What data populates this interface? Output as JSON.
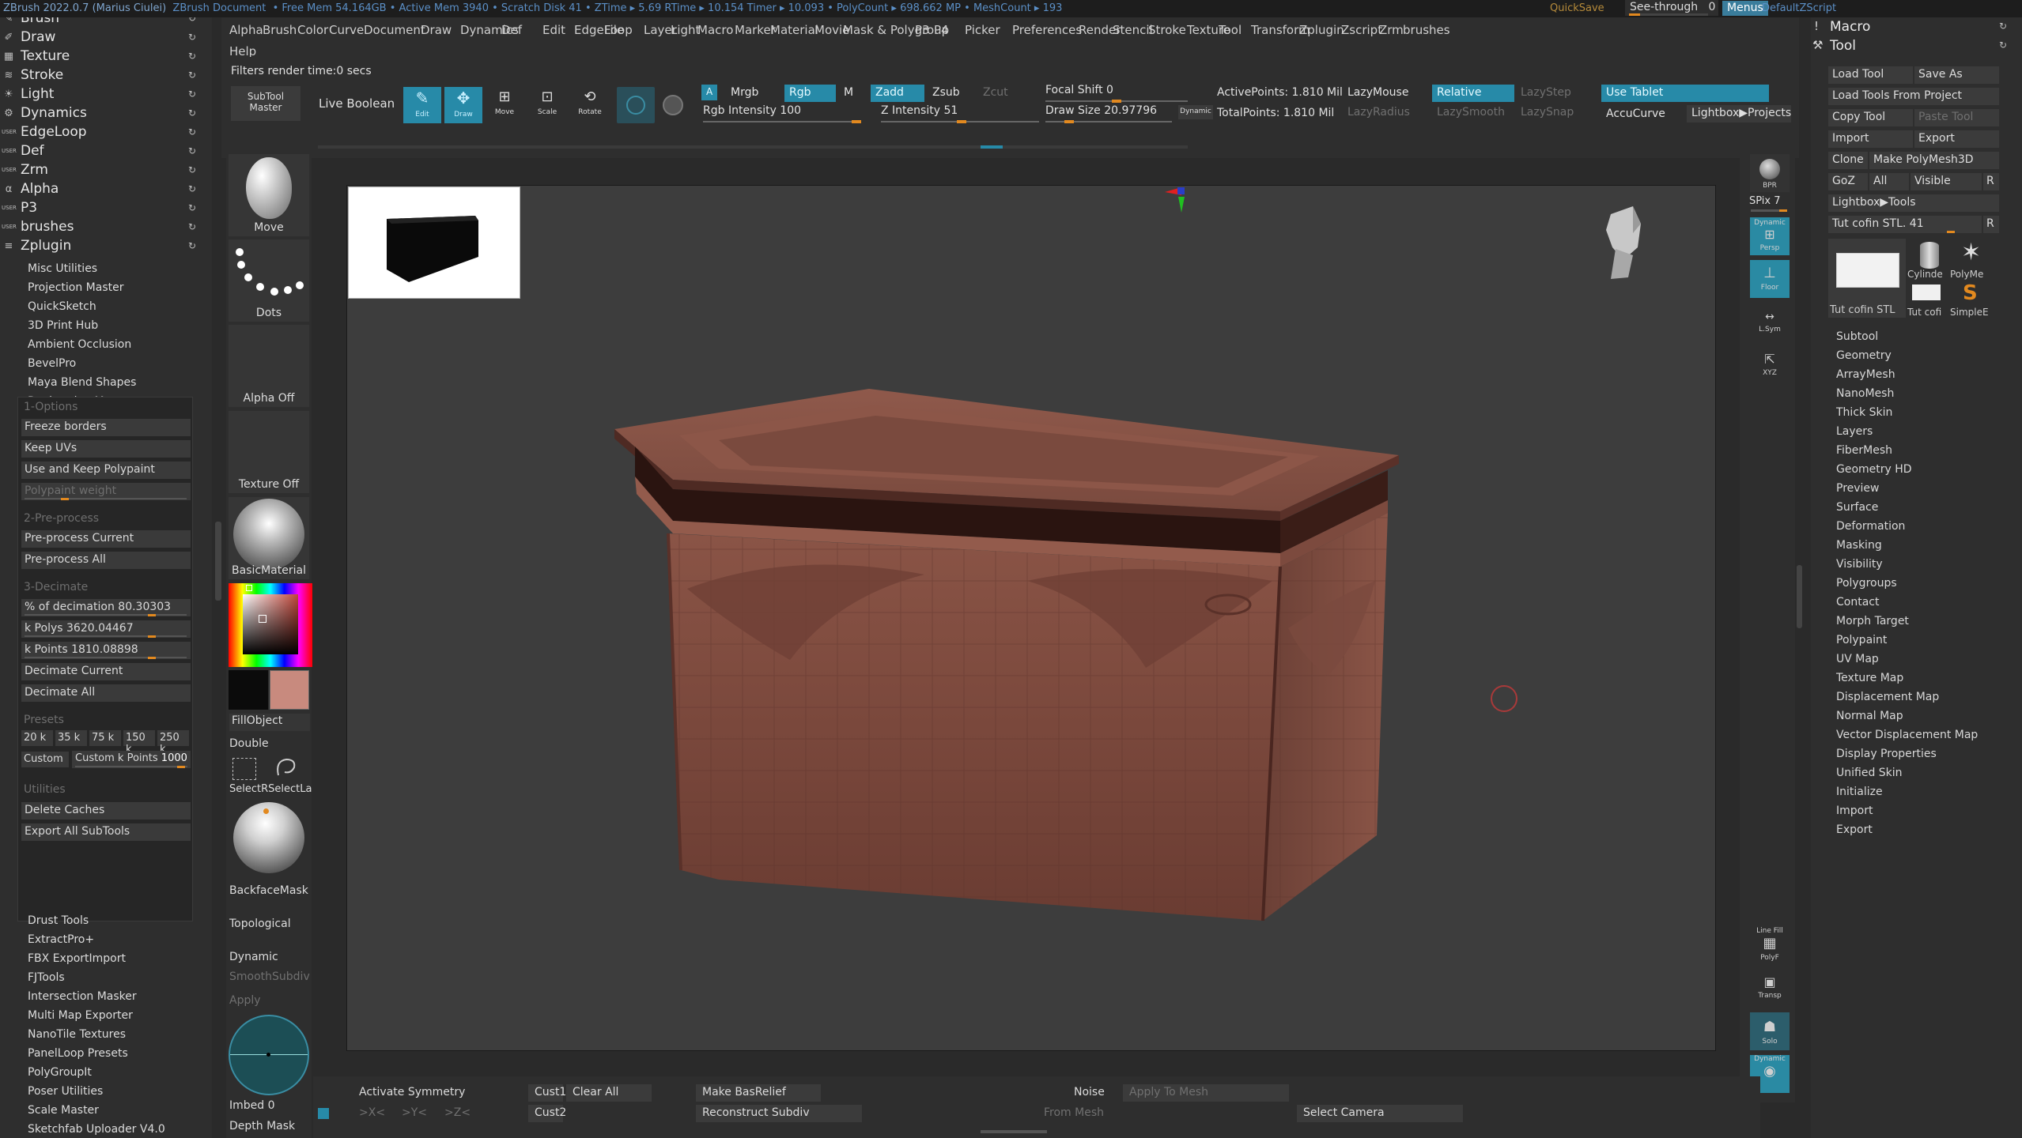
{
  "titlebar": {
    "app": "ZBrush 2022.0.7 (Marius Ciulei)",
    "doc": "ZBrush Document",
    "stats": "• Free Mem 54.164GB • Active Mem 3940 • Scratch Disk 41 • ZTime ▸ 5.69 RTime ▸ 10.154 Timer ▸ 10.093 • PolyCount ▸ 698.662 MP • MeshCount ▸ 193",
    "quicksave": "QuickSave",
    "seethrough": "See-through",
    "seethrough_value": "0",
    "seethrough_level": 0.0,
    "menus": "Menus",
    "default_zscript": "DefaultZScript"
  },
  "menubar": {
    "items": [
      "Alpha",
      "Brush",
      "Color",
      "Curve",
      "Document",
      "Draw",
      "Dynamics",
      "Def",
      "Edit",
      "EdgeLoop",
      "File",
      "Layer",
      "Light",
      "Macro",
      "Marker",
      "Material",
      "Movie",
      "Mask & Polygroup",
      "P3",
      "P4",
      "Picker",
      "Preferences",
      "Render",
      "Stencil",
      "Stroke",
      "Texture",
      "Tool",
      "Transform",
      "Zplugin",
      "Zscript",
      "Zrm",
      "brushes"
    ],
    "help": "Help"
  },
  "left_panel": {
    "menus": [
      {
        "label": "Brush",
        "icon": "brush-icon"
      },
      {
        "label": "Draw",
        "icon": "draw-icon"
      },
      {
        "label": "Texture",
        "icon": "texture-icon"
      },
      {
        "label": "Stroke",
        "icon": "stroke-icon"
      },
      {
        "label": "Light",
        "icon": "light-icon"
      },
      {
        "label": "Dynamics",
        "icon": "dynamics-icon"
      },
      {
        "label": "EdgeLoop",
        "icon": "user-icon"
      },
      {
        "label": "Def",
        "icon": "user-icon"
      },
      {
        "label": "Zrm",
        "icon": "user-icon"
      },
      {
        "label": "Alpha",
        "icon": "alpha-icon"
      },
      {
        "label": "P3",
        "icon": "user-icon"
      },
      {
        "label": "brushes",
        "icon": "user-icon"
      },
      {
        "label": "Zplugin",
        "icon": "plugin-icon"
      }
    ],
    "user_tag": "USER",
    "plugins_top": [
      "Misc Utilities",
      "Projection Master",
      "QuickSketch",
      "3D Print Hub",
      "Ambient Occlusion",
      "BevelPro",
      "Maya Blend Shapes",
      "Decimation Master"
    ],
    "plugins_bottom": [
      "Drust Tools",
      "ExtractPro+",
      "FBX ExportImport",
      "FJTools",
      "Intersection Masker",
      "Multi Map Exporter",
      "NanoTile Textures",
      "PanelLoop Presets",
      "PolyGroupIt",
      "Poser Utilities",
      "Scale Master",
      "Sketchfab Uploader V4.0"
    ],
    "decimation": {
      "sec1": "1-Options",
      "freeze_borders": "Freeze borders",
      "keep_uvs": "Keep UVs",
      "use_keep_polypaint": "Use and Keep Polypaint",
      "polypaint_weight": "Polypaint weight",
      "sec2": "2-Pre-process",
      "preprocess_current": "Pre-process Current",
      "preprocess_all": "Pre-process All",
      "sec3": "3-Decimate",
      "pct_label": "% of decimation",
      "pct_value": "80.30303",
      "kpolys_label": "k Polys",
      "kpolys_value": "3620.04467",
      "kpoints_label": "k Points",
      "kpoints_value": "1810.08898",
      "decimate_current": "Decimate Current",
      "decimate_all": "Decimate All",
      "presets_label": "Presets",
      "presets": [
        "20 k",
        "35 k",
        "75 k",
        "150 k",
        "250 k"
      ],
      "custom": "Custom",
      "custom_kpoints_label": "Custom k Points",
      "custom_kpoints_value": "1000",
      "utilities_label": "Utilities",
      "delete_caches": "Delete Caches",
      "export_all": "Export All SubTools"
    }
  },
  "shelf": {
    "subtool_master": "SubTool Master",
    "live_boolean": "Live Boolean",
    "edit": "Edit",
    "draw": "Draw",
    "move": "Move",
    "scale": "Scale",
    "rotate": "Rotate",
    "a": "A",
    "mrgb": "Mrgb",
    "rgb": "Rgb",
    "m": "M",
    "zadd": "Zadd",
    "zsub": "Zsub",
    "zcut": "Zcut",
    "rgb_intensity_label": "Rgb Intensity",
    "rgb_intensity_value": "100",
    "z_intensity_label": "Z Intensity",
    "z_intensity_value": "51",
    "focal_shift_label": "Focal Shift",
    "focal_shift_value": "0",
    "draw_size_label": "Draw Size",
    "draw_size_value": "20.97796",
    "dynamic": "Dynamic",
    "active_points": "ActivePoints: 1.810 Mil",
    "total_points": "TotalPoints: 1.810 Mil",
    "lazymouse": "LazyMouse",
    "lazyradius": "LazyRadius",
    "relative": "Relative",
    "lazysmooth": "LazySmooth",
    "lazystep": "LazyStep",
    "lazysnap": "LazySnap",
    "use_tablet": "Use Tablet",
    "accucurve": "AccuCurve",
    "lightbox_projects": "Lightbox▶Projects",
    "render_notice": "Filters render time:0 secs"
  },
  "tool_palette": {
    "move": "Move",
    "dots": "Dots",
    "alpha_off": "Alpha Off",
    "texture_off": "Texture Off",
    "basic_material": "BasicMaterial",
    "fill_object": "FillObject",
    "double": "Double",
    "select_rect": "SelectR",
    "select_lasso": "SelectLa",
    "backface_mask": "BackfaceMask",
    "topological": "Topological",
    "dynamic": "Dynamic",
    "smooth_subdiv": "SmoothSubdiv",
    "apply": "Apply",
    "imbed_label": "Imbed",
    "imbed_value": "0",
    "depth_mask": "Depth Mask",
    "main_color": "#c88a7e"
  },
  "right_strip": {
    "bpr": "BPR",
    "spix_label": "SPix",
    "spix_value": "7",
    "dynamic": "Dynamic",
    "persp": "Persp",
    "floor": "Floor",
    "lsym": "L.Sym",
    "xyz": "XYZ",
    "line_fill": "Line Fill",
    "polyf": "PolyF",
    "transp": "Transp",
    "solo": "Solo",
    "dynamic2": "Dynamic"
  },
  "right_panel": {
    "macro": "Macro",
    "tool": "Tool",
    "load_tool": "Load Tool",
    "save_as": "Save As",
    "load_from_project": "Load Tools From Project",
    "copy_tool": "Copy Tool",
    "paste_tool": "Paste Tool",
    "import": "Import",
    "export": "Export",
    "clone": "Clone",
    "make_polymesh": "Make PolyMesh3D",
    "goz": "GoZ",
    "all": "All",
    "visible": "Visible",
    "r": "R",
    "lightbox_tools": "Lightbox▶Tools",
    "current_tool_label": "Tut cofin STL.",
    "current_tool_value": "41",
    "thumb_main": "Tut cofin STL",
    "thumb_cyl": "Cylinde",
    "thumb_poly": "PolyMe",
    "thumb_tut": "Tut cofi",
    "thumb_simple": "SimpleE",
    "subpalettes": [
      "Subtool",
      "Geometry",
      "ArrayMesh",
      "NanoMesh",
      "Thick Skin",
      "Layers",
      "FiberMesh",
      "Geometry HD",
      "Preview",
      "Surface",
      "Deformation",
      "Masking",
      "Visibility",
      "Polygroups",
      "Contact",
      "Morph Target",
      "Polypaint",
      "UV Map",
      "Texture Map",
      "Displacement Map",
      "Normal Map",
      "Vector Displacement Map",
      "Display Properties",
      "Unified Skin",
      "Initialize",
      "Import",
      "Export"
    ]
  },
  "bottom_bar": {
    "activate_symmetry": "Activate Symmetry",
    "x": ">X<",
    "y": ">Y<",
    "z": ">Z<",
    "cust1": "Cust1",
    "cust2": "Cust2",
    "clear_all": "Clear All",
    "make_basrelief": "Make BasRelief",
    "reconstruct_subdiv": "Reconstruct Subdiv",
    "noise": "Noise",
    "apply_to_mesh": "Apply To Mesh",
    "from_mesh": "From Mesh",
    "select_camera": "Select Camera"
  },
  "colors": {
    "accent": "#278aa8",
    "slider_knob": "#e2891f",
    "mesh": "#7b4a3f",
    "mesh_dark": "#3a1f1a"
  }
}
